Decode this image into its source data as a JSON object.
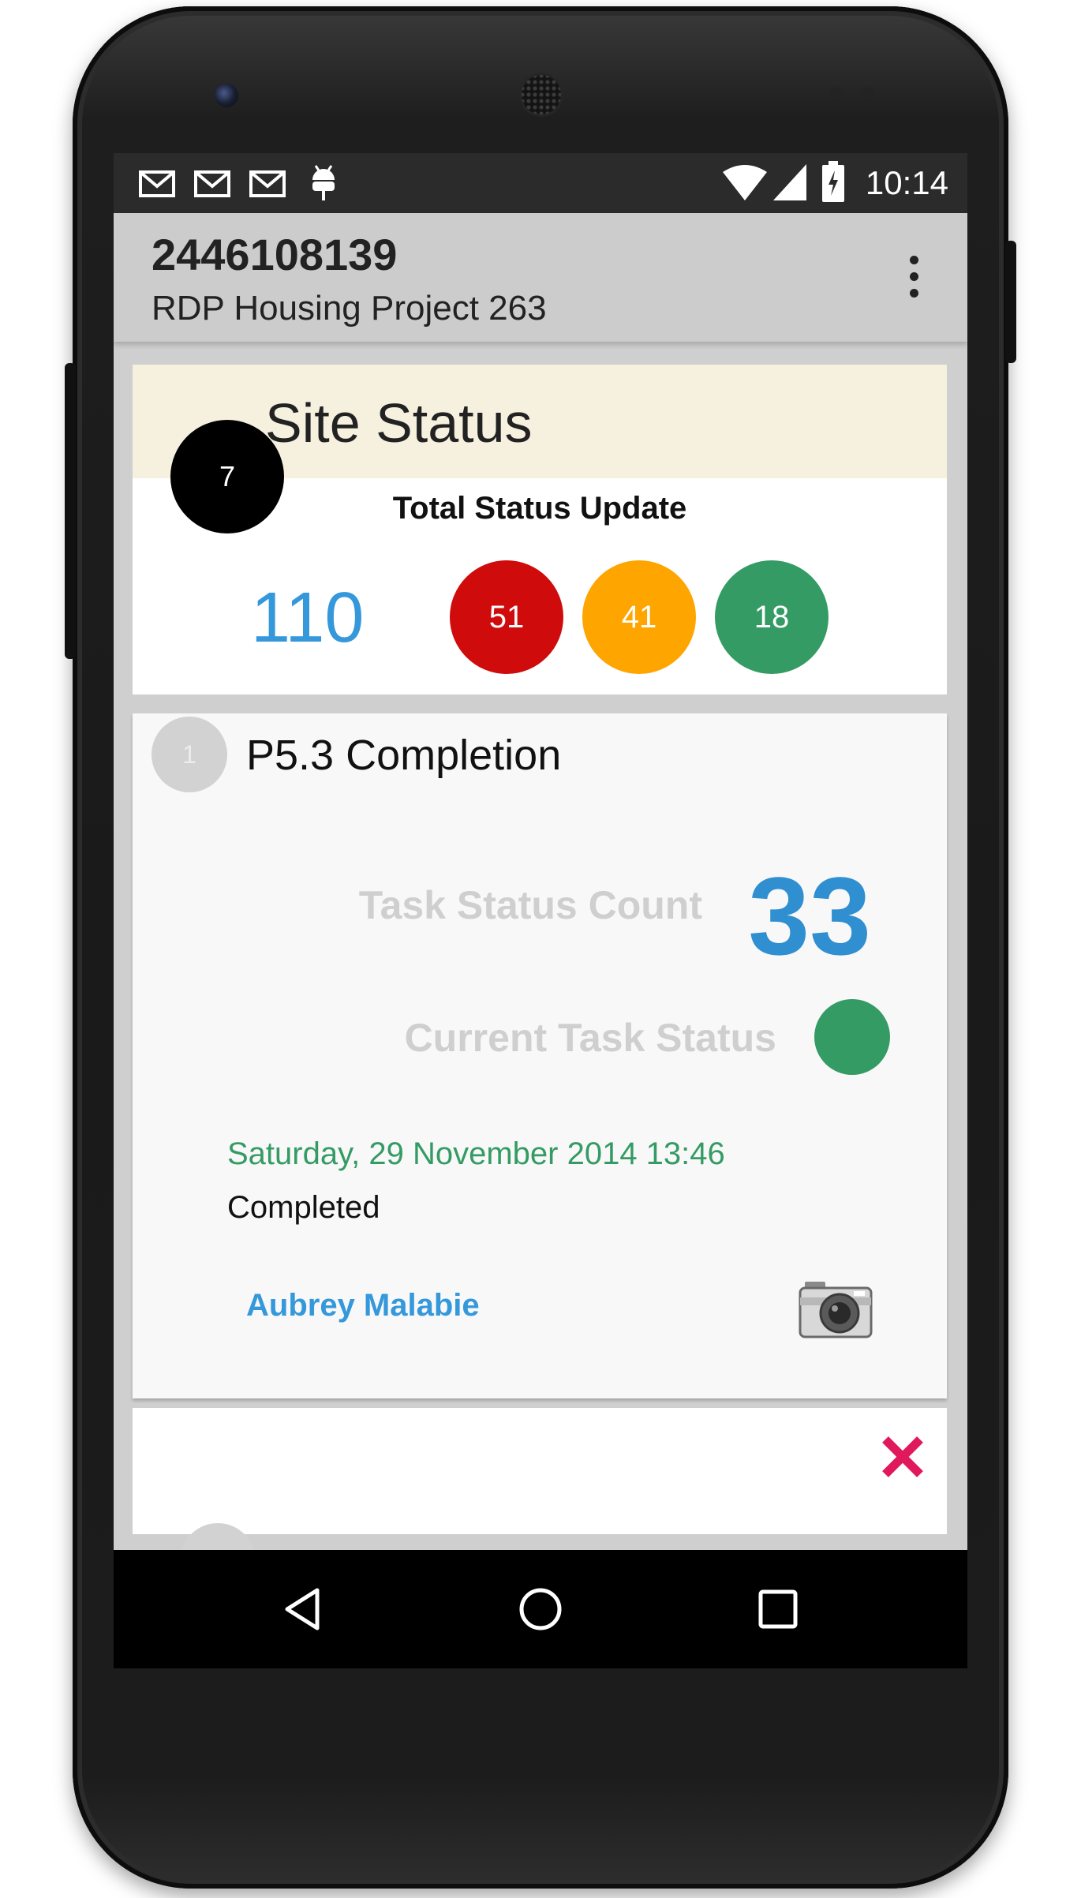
{
  "status_bar": {
    "time": "10:14",
    "icons": [
      "gmail-icon",
      "gmail-icon",
      "gmail-icon",
      "android-debug-icon",
      "wifi-icon",
      "signal-icon",
      "battery-charging-icon"
    ]
  },
  "app_bar": {
    "title": "2446108139",
    "subtitle": "RDP Housing Project 263",
    "overflow_icon": "more-vert-icon"
  },
  "site_status": {
    "title": "Site Status",
    "badge": "7",
    "total_label": "Total Status Update",
    "total": "110",
    "counts": [
      {
        "value": "51",
        "color": "#d00b0b"
      },
      {
        "value": "41",
        "color": "#ffa500"
      },
      {
        "value": "18",
        "color": "#359b64"
      }
    ]
  },
  "task": {
    "step": "1",
    "title": "P5.3 Completion",
    "count_label": "Task Status Count",
    "count": "33",
    "current_label": "Current Task Status",
    "current_color": "#359b64",
    "date": "Saturday, 29 November 2014 13:46",
    "state": "Completed",
    "user": "Aubrey Malabie",
    "camera_icon": "camera-icon"
  },
  "next_card": {
    "close_icon": "close-icon",
    "close_color": "#e0185c"
  },
  "nav_bar": {
    "buttons": [
      "back-icon",
      "home-icon",
      "recents-icon"
    ]
  },
  "colors": {
    "accent_blue": "#3498db",
    "green": "#359b64",
    "red": "#d00b0b",
    "orange": "#ffa500"
  }
}
